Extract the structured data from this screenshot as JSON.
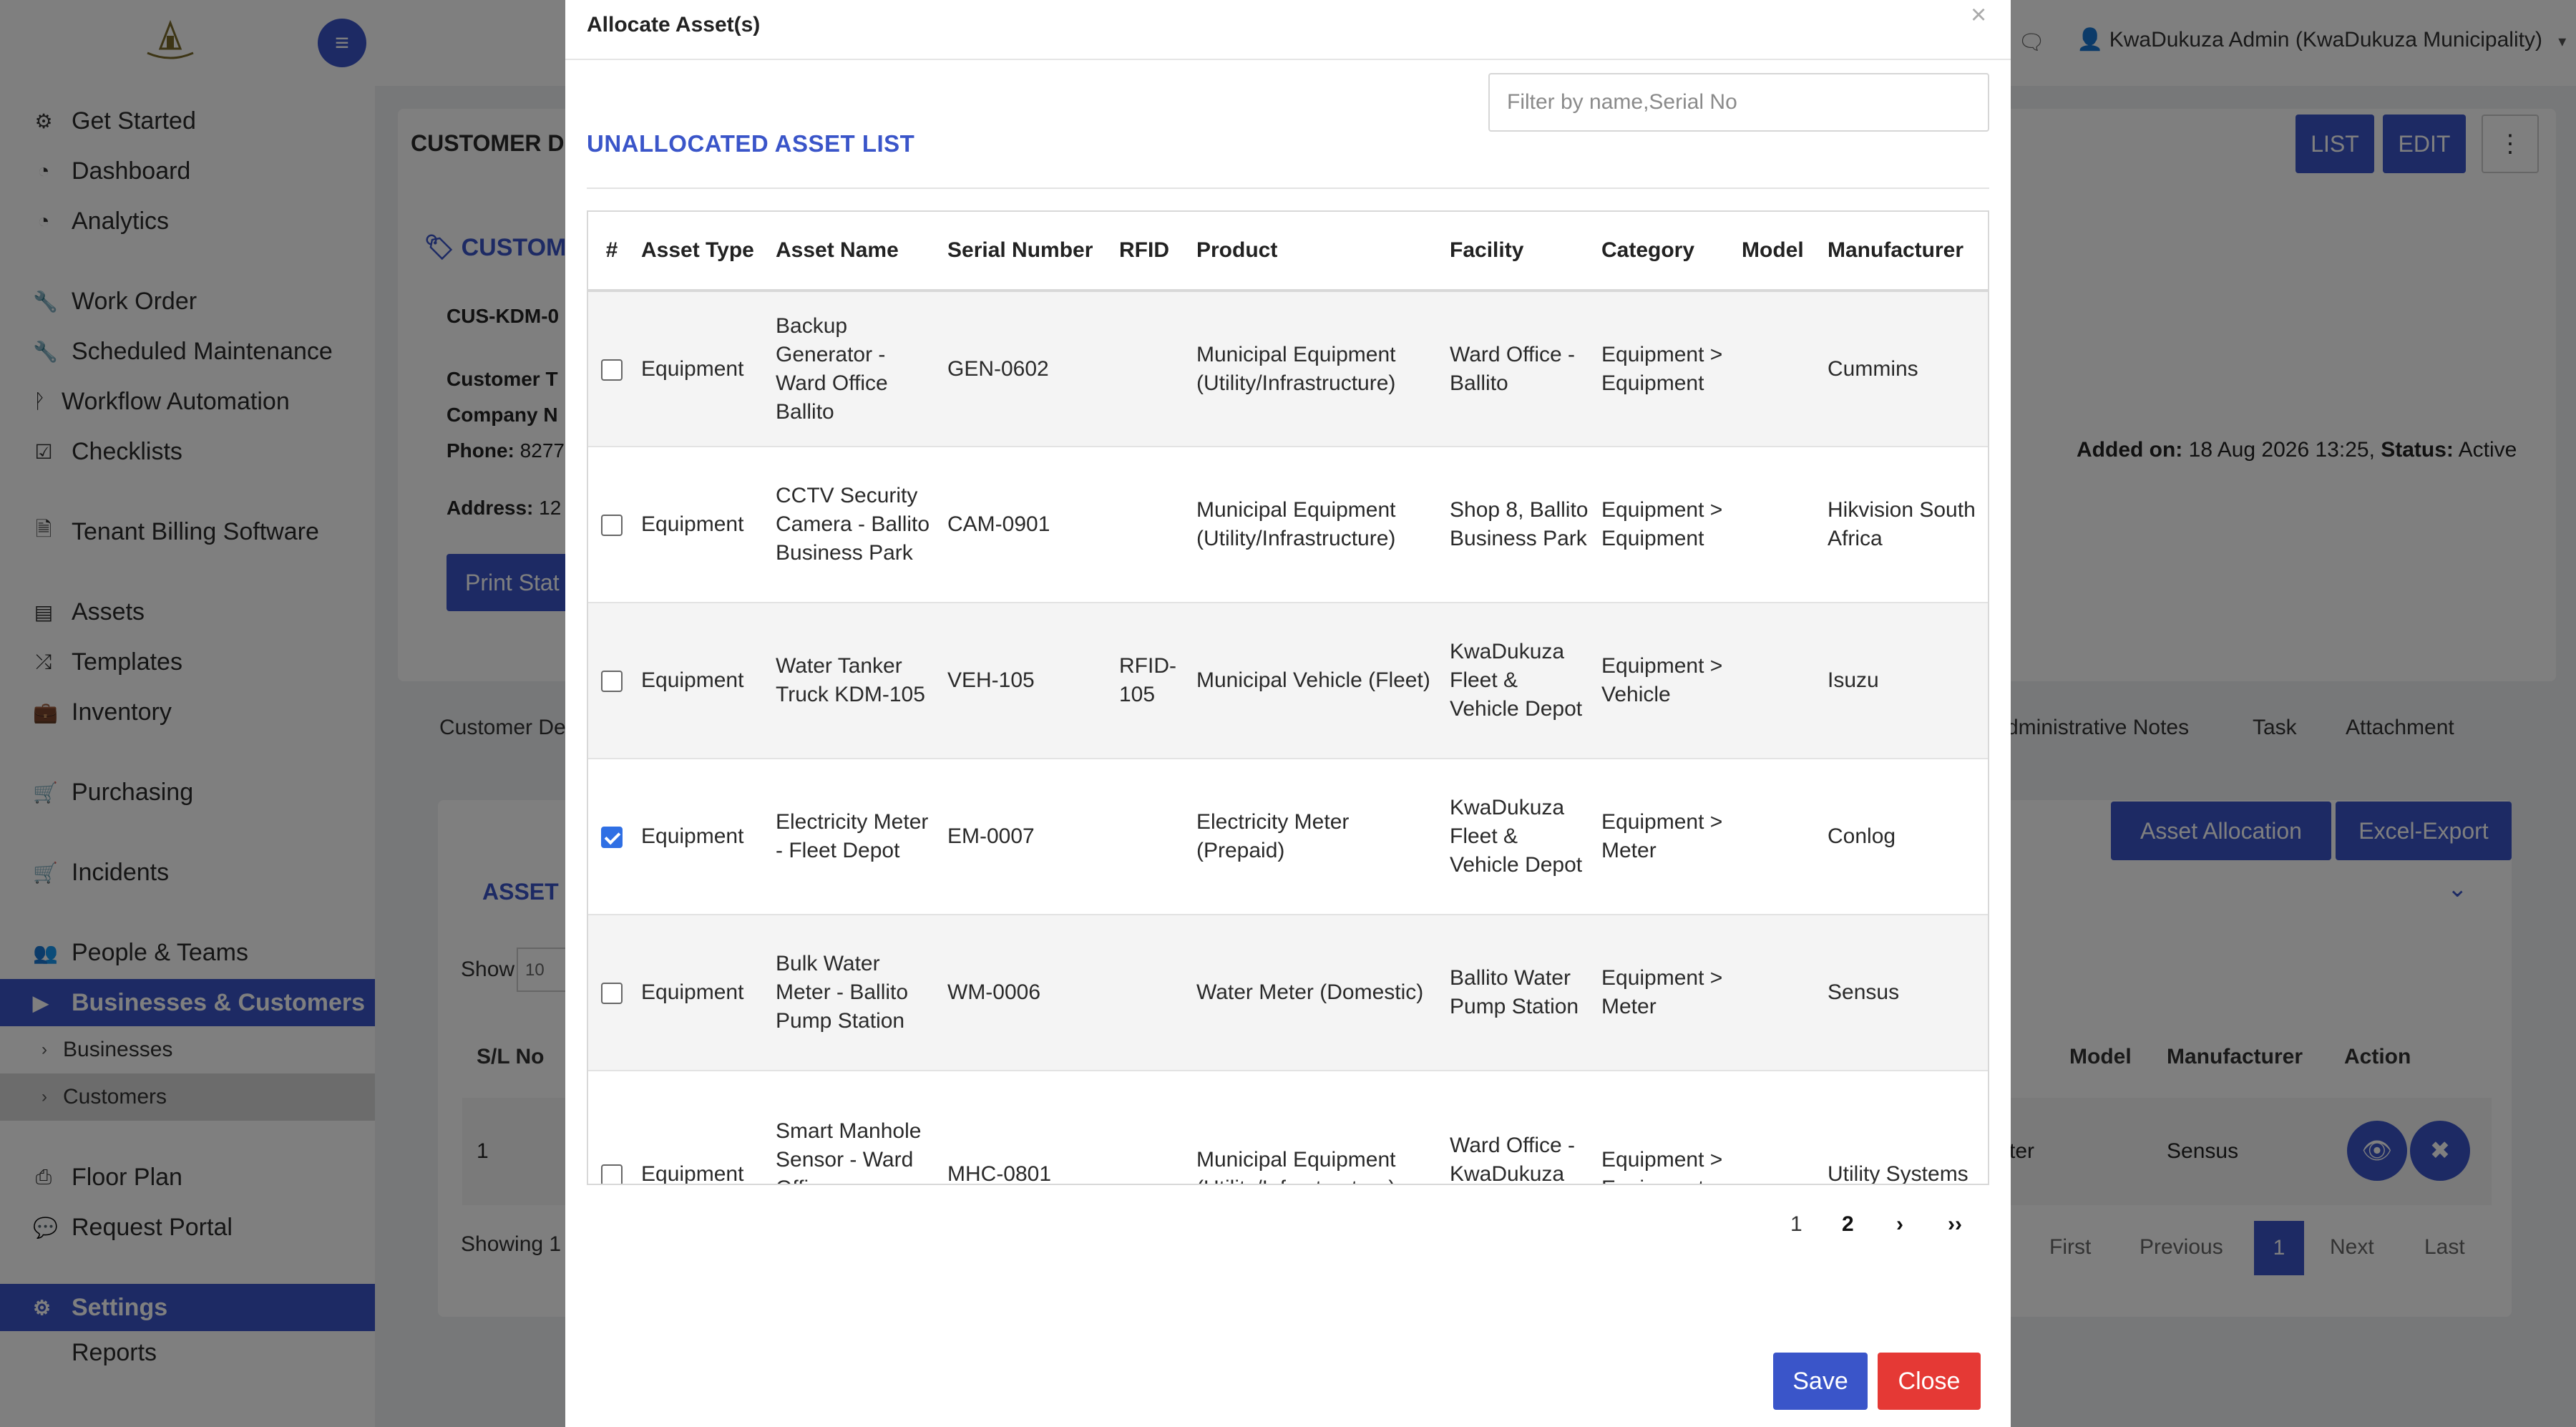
{
  "topbar": {
    "user_label": "KwaDukuza Admin (KwaDukuza Municipality)"
  },
  "sidebar": {
    "items": [
      {
        "label": "Get Started",
        "icon": "gears-icon"
      },
      {
        "label": "Dashboard",
        "icon": "gauge-icon"
      },
      {
        "label": "Analytics",
        "icon": "gauge-icon"
      },
      {
        "label": "Work Order",
        "icon": "wrench-icon"
      },
      {
        "label": "Scheduled Maintenance",
        "icon": "wrench-icon"
      },
      {
        "label": "Workflow Automation",
        "icon": "branch-icon"
      },
      {
        "label": "Checklists",
        "icon": "checkbox-icon"
      },
      {
        "label": "Tenant Billing Software",
        "icon": "document-icon"
      },
      {
        "label": "Assets",
        "icon": "archive-icon"
      },
      {
        "label": "Templates",
        "icon": "shuffle-icon"
      },
      {
        "label": "Inventory",
        "icon": "briefcase-icon"
      },
      {
        "label": "Purchasing",
        "icon": "cart-icon"
      },
      {
        "label": "Incidents",
        "icon": "cart-icon"
      },
      {
        "label": "People & Teams",
        "icon": "users-icon"
      },
      {
        "label": "Businesses & Customers",
        "icon": "video-icon"
      }
    ],
    "sub_items": [
      "Businesses",
      "Customers"
    ],
    "lower_items": [
      {
        "label": "Floor Plan",
        "icon": "printer-icon"
      },
      {
        "label": "Request Portal",
        "icon": "chat-icon"
      }
    ],
    "settings": "Settings",
    "reports": "Reports"
  },
  "background": {
    "customer_header": "CUSTOMER DE",
    "list_btn": "LIST",
    "edit_btn": "EDIT",
    "customer_tag": "CUSTOME",
    "cus_code": "CUS-KDM-0",
    "customer_type": "Customer T",
    "company": "Company N",
    "phone_label": "Phone:",
    "phone_value": "8277",
    "address_label": "Address:",
    "address_value": "12",
    "added_on_label": "Added on:",
    "added_on_value": "18 Aug 2026 13:25,",
    "status_label": "Status:",
    "status_value": "Active",
    "print_btn": "Print Stat",
    "tabs": {
      "customer": "Customer De",
      "admin_notes": "dministrative Notes",
      "task": "Task",
      "attachment": "Attachment"
    },
    "asset_allocation_btn": "Asset Allocation",
    "excel_export_btn": "Excel-Export",
    "asset_list": "ASSET L",
    "show": "Show",
    "show_value": "10",
    "headers": {
      "sl": "S/L No",
      "model": "Model",
      "manufacturer": "Manufacturer",
      "action": "Action"
    },
    "row": {
      "sl": "1",
      "frag": "ter",
      "manufacturer": "Sensus"
    },
    "showing": "Showing 1",
    "pager": {
      "first": "First",
      "previous": "Previous",
      "current": "1",
      "next": "Next",
      "last": "Last"
    }
  },
  "modal": {
    "title": "Allocate Asset(s)",
    "close_x": "×",
    "filter_placeholder": "Filter by name,Serial No",
    "list_title": "UNALLOCATED ASSET LIST",
    "columns": [
      "#",
      "Asset Type",
      "Asset Name",
      "Serial Number",
      "RFID",
      "Product",
      "Facility",
      "Category",
      "Model",
      "Manufacturer"
    ],
    "rows": [
      {
        "checked": false,
        "type": "Equipment",
        "name": "Backup Generator - Ward Office Ballito",
        "serial": "GEN-0602",
        "rfid": "",
        "product": "Municipal Equipment (Utility/Infrastructure)",
        "facility": "Ward Office - Ballito",
        "category": "Equipment > Equipment",
        "model": "",
        "manufacturer": "Cummins"
      },
      {
        "checked": false,
        "type": "Equipment",
        "name": "CCTV Security Camera - Ballito Business Park",
        "serial": "CAM-0901",
        "rfid": "",
        "product": "Municipal Equipment (Utility/Infrastructure)",
        "facility": "Shop 8, Ballito Business Park",
        "category": "Equipment > Equipment",
        "model": "",
        "manufacturer": "Hikvision South Africa"
      },
      {
        "checked": false,
        "type": "Equipment",
        "name": "Water Tanker Truck KDM-105",
        "serial": "VEH-105",
        "rfid": "RFID-105",
        "product": "Municipal Vehicle (Fleet)",
        "facility": "KwaDukuza Fleet & Vehicle Depot",
        "category": "Equipment > Vehicle",
        "model": "",
        "manufacturer": "Isuzu"
      },
      {
        "checked": true,
        "type": "Equipment",
        "name": "Electricity Meter - Fleet Depot",
        "serial": "EM-0007",
        "rfid": "",
        "product": "Electricity Meter (Prepaid)",
        "facility": "KwaDukuza Fleet & Vehicle Depot",
        "category": "Equipment > Meter",
        "model": "",
        "manufacturer": "Conlog"
      },
      {
        "checked": false,
        "type": "Equipment",
        "name": "Bulk Water Meter - Ballito Pump Station",
        "serial": "WM-0006",
        "rfid": "",
        "product": "Water Meter (Domestic)",
        "facility": "Ballito Water Pump Station",
        "category": "Equipment > Meter",
        "model": "",
        "manufacturer": "Sensus"
      },
      {
        "checked": false,
        "type": "Equipment",
        "name": "Smart Manhole Sensor - Ward Office KwaDukuza",
        "serial": "MHC-0801",
        "rfid": "",
        "product": "Municipal Equipment (Utility/Infrastructure)",
        "facility": "Ward Office - KwaDukuza (Stanger)",
        "category": "Equipment > Equipment",
        "model": "",
        "manufacturer": "Utility Systems"
      }
    ],
    "pager": {
      "p1": "1",
      "p2": "2",
      "next": "›",
      "last": "››"
    },
    "save": "Save",
    "close": "Close"
  }
}
